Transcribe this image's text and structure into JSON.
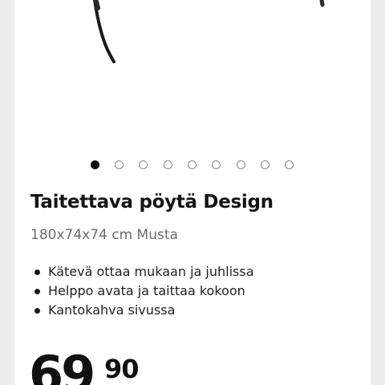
{
  "product": {
    "title": "Taitettava pöytä Design",
    "subtitle": "180x74x74 cm Musta",
    "features": [
      "Kätevä ottaa mukaan ja juhlissa",
      "Helppo avata ja taittaa kokoon",
      "Kantokahva sivussa"
    ],
    "price_integer": "69",
    "price_decimals": "90"
  },
  "carousel": {
    "image_count": 9,
    "active_index": 0
  },
  "colors": {
    "page_background": "#ececec",
    "card_background": "#ffffff",
    "text_primary": "#151515",
    "text_secondary": "#6b6b6b",
    "dot_active": "#111111",
    "dot_inactive_border": "#8a8a8a"
  }
}
